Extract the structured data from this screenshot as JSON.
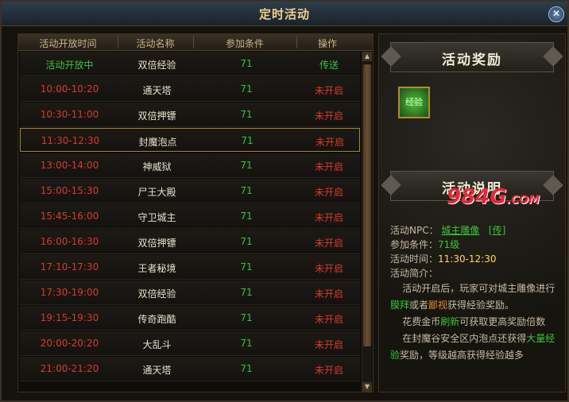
{
  "window": {
    "title": "定时活动",
    "close_label": "✕"
  },
  "table": {
    "headers": [
      "活动开放时间",
      "活动名称",
      "参加条件",
      "操作"
    ],
    "rows": [
      {
        "time": "活动开放中",
        "name": "双倍经验",
        "level": "71",
        "action": "传送",
        "status": "open"
      },
      {
        "time": "10:00-10:20",
        "name": "通天塔",
        "level": "71",
        "action": "未开启",
        "status": "closed"
      },
      {
        "time": "10:30-11:00",
        "name": "双倍押镖",
        "level": "71",
        "action": "未开启",
        "status": "closed"
      },
      {
        "time": "11:30-12:30",
        "name": "封魔泡点",
        "level": "71",
        "action": "未开启",
        "status": "selected"
      },
      {
        "time": "13:00-14:00",
        "name": "神威狱",
        "level": "71",
        "action": "未开启",
        "status": "closed"
      },
      {
        "time": "15:00-15:30",
        "name": "尸王大殿",
        "level": "71",
        "action": "未开启",
        "status": "closed"
      },
      {
        "time": "15:45-16:00",
        "name": "守卫城主",
        "level": "71",
        "action": "未开启",
        "status": "closed"
      },
      {
        "time": "16:00-16:30",
        "name": "双倍押镖",
        "level": "71",
        "action": "未开启",
        "status": "closed"
      },
      {
        "time": "17:10-17:30",
        "name": "王者秘境",
        "level": "71",
        "action": "未开启",
        "status": "closed"
      },
      {
        "time": "17:30-19:00",
        "name": "双倍经验",
        "level": "71",
        "action": "未开启",
        "status": "closed"
      },
      {
        "time": "19:15-19:30",
        "name": "传奇跑酷",
        "level": "71",
        "action": "未开启",
        "status": "closed"
      },
      {
        "time": "20:00-20:20",
        "name": "大乱斗",
        "level": "71",
        "action": "未开启",
        "status": "closed"
      },
      {
        "time": "21:00-21:20",
        "name": "通天塔",
        "level": "71",
        "action": "未开启",
        "status": "closed"
      }
    ]
  },
  "scrollbar": {
    "up": "▲",
    "down": "▼"
  },
  "rewards": {
    "title": "活动奖励",
    "item_label": "经验"
  },
  "description": {
    "title": "活动说明",
    "watermark_main": "984G",
    "watermark_suffix": ".COM",
    "npc_label": "活动NPC：",
    "npc_name": "城主雕像",
    "npc_teleport": "[传]",
    "level_label": "参加条件：",
    "level_value": "71级",
    "time_label": "活动时间：",
    "time_value": "11:30-12:30",
    "intro_label": "活动简介：",
    "para1_a": "活动开启后，玩家可对城主雕像进行",
    "para1_b": "膜拜",
    "para1_c": "或者",
    "para1_d": "鄙视",
    "para1_e": "获得经验奖励。",
    "para2_a": "花费金币",
    "para2_b": "刷新",
    "para2_c": "可获取更高奖励倍数",
    "para3_a": "在封魔谷安全区内泡点还获得",
    "para3_b": "大量经验",
    "para3_c": "奖励，等级越高获得经验越多"
  }
}
